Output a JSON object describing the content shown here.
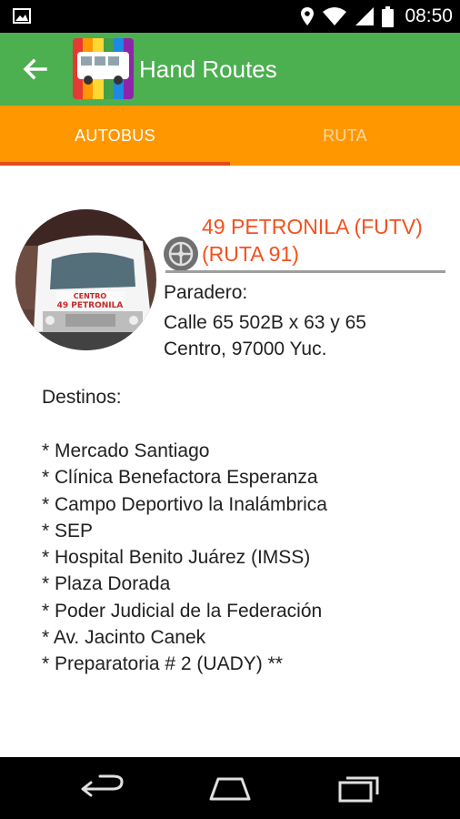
{
  "status_bar": {
    "time": "08:50",
    "icons": [
      "image-notification-icon",
      "location-icon",
      "wifi-icon",
      "signal-icon",
      "battery-icon"
    ]
  },
  "app_bar": {
    "title": "Hand Routes",
    "color": "#4caf50"
  },
  "tabs": {
    "items": [
      {
        "label": "AUTOBUS",
        "selected": true
      },
      {
        "label": "RUTA",
        "selected": false
      }
    ],
    "color": "#ff9800",
    "indicator_color": "#e64a19"
  },
  "route": {
    "title": "49 PETRONILA (FUTV) (RUTA 91)",
    "title_color": "#f4511e",
    "paradero_label": "Paradero:",
    "address_line1": "Calle 65 502B x 63 y 65",
    "address_line2": "Centro, 97000 Yuc.",
    "destinos_label": "Destinos:",
    "destinos": [
      "* Mercado Santiago",
      "* Clínica Benefactora Esperanza",
      "* Campo Deportivo la Inalámbrica",
      "* SEP",
      "* Hospital Benito Juárez (IMSS)",
      "* Plaza Dorada",
      "* Poder Judicial de la Federación",
      "* Av. Jacinto Canek",
      "* Preparatoria # 2 (UADY) **"
    ]
  },
  "nav_bar": {
    "buttons": [
      "back-icon",
      "home-icon",
      "recents-icon"
    ]
  }
}
